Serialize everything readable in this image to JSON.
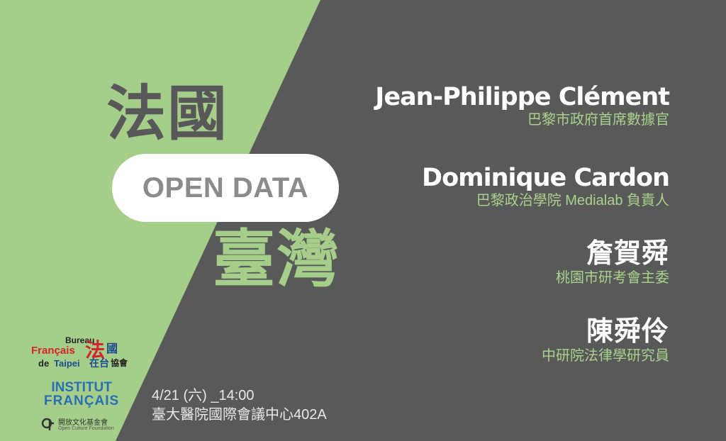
{
  "colors": {
    "green": "#a5ce8a",
    "dark_gray": "#595959",
    "white": "#ffffff",
    "pill_text": "#8b8b8b",
    "role_green": "#a8d28c"
  },
  "title": {
    "top": "法國",
    "pill": "OPEN DATA",
    "bottom": "臺灣"
  },
  "speakers": [
    {
      "name": "Jean-Philippe Clément",
      "role": "巴黎市政府首席數據官"
    },
    {
      "name": "Dominique Cardon",
      "role": "巴黎政治學院 Medialab 負責人"
    },
    {
      "name": "詹賀舜",
      "role": "桃園市研考會主委"
    },
    {
      "name": "陳舜伶",
      "role": "中研院法律學研究員"
    }
  ],
  "event": {
    "datetime": "4/21 (六) _14:00",
    "venue": "臺大醫院國際會議中心402A"
  },
  "logos": {
    "bureau": {
      "bureau": "Bureau",
      "francais": "Français",
      "de": "de",
      "taipei": "Taipei",
      "fa": "法",
      "guo": "國",
      "zaitai": "在台",
      "xiehui": "協會"
    },
    "institut": {
      "line1": "INSTITUT",
      "line2": "FRANÇAIS"
    },
    "ocf": {
      "zh": "開放文化基金會",
      "en": "Open Culture Foundation",
      "icon": "ocf-logo-icon"
    }
  }
}
